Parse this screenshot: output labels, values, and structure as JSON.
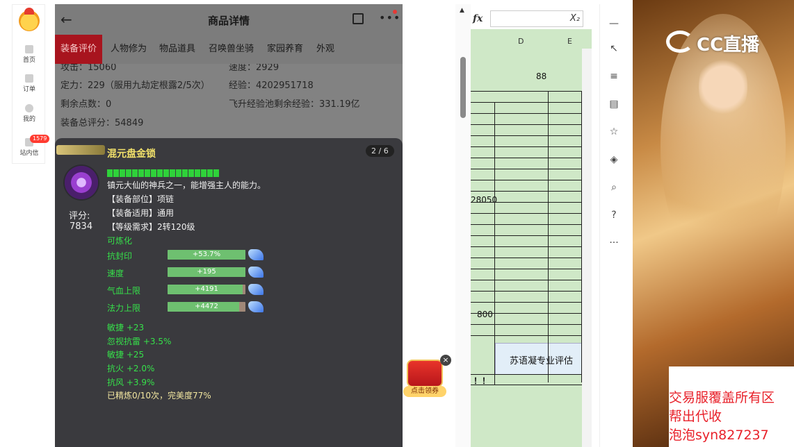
{
  "left_nav": {
    "items": [
      {
        "label": "首页"
      },
      {
        "label": "订单"
      },
      {
        "label": "我的"
      },
      {
        "label": "站内信",
        "badge": "1579"
      }
    ]
  },
  "phone": {
    "title": "商品详情",
    "back_icon": "←",
    "more_icon": "•••",
    "tabs": [
      "装备评价",
      "人物修为",
      "物品道具",
      "召唤兽坐骑",
      "家园养育",
      "外观"
    ],
    "stats": {
      "attack": "攻击：15060",
      "speed": "速度：2929",
      "ding_li": "定力：229（服用九劫定根露2/5次）",
      "exp": "经验：4202951718",
      "remaining_points": "剩余点数：0",
      "feisheng_exp": "飞升经验池剩余经验：331.19亿",
      "equip_score": "装备总评分：54849"
    },
    "card": {
      "name": "混元盘金锁",
      "page": "2 / 6",
      "score_label": "评分:",
      "score_value": "7834",
      "desc": "镇元大仙的神兵之一，能增强主人的能力。",
      "slot": "【装备部位】项链",
      "applies": "【装备适用】通用",
      "level_req": "【等级需求】2转120级",
      "refinable": "可炼化",
      "refine_bars": [
        {
          "label": "抗封印",
          "value": "+53.7%",
          "fill": 1.0
        },
        {
          "label": "速度",
          "value": "+195",
          "fill": 1.0
        },
        {
          "label": "气血上限",
          "value": "+4191",
          "fill": 0.96
        },
        {
          "label": "法力上限",
          "value": "+4472",
          "fill": 0.92
        }
      ],
      "extra_attrs": [
        "敏捷 +23",
        "忽视抗雷 +3.5%",
        "敏捷 +25",
        "抗火 +2.0%",
        "抗风 +3.9%"
      ],
      "refine_status": "已精炼0/10次，完美度77%"
    },
    "envelope_label": "点击领券",
    "close_icon": "×"
  },
  "sheet": {
    "fx": "fx",
    "fx_right": "X₂",
    "col_d": "D",
    "col_e": "E",
    "value_88": "88",
    "value_28050": "28050",
    "value_800": "800",
    "assess_text": "苏语凝专业评估",
    "bang": "！！"
  },
  "stream": {
    "logo_text": "CC直播",
    "promo": [
      "交易服覆盖所有区",
      "帮出代收",
      "泡泡syn827237"
    ]
  },
  "colors": {
    "active_tab": "#a8141e",
    "item_name": "#f1e06a",
    "attr_green": "#36e04a",
    "promo_red": "#e8212a",
    "sheet_bg": "#cfe8c7"
  }
}
